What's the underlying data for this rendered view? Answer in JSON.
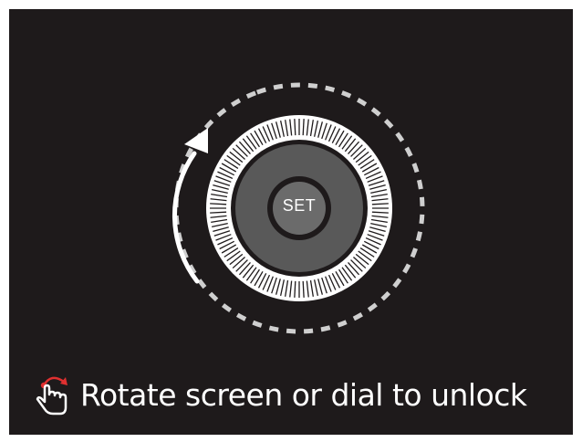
{
  "dial": {
    "center_label": "SET"
  },
  "hint": {
    "text": "Rotate screen or dial to unlock",
    "icon": "rotate-gesture-hand-icon"
  },
  "colors": {
    "screen_background": "#1e1a1b",
    "dial_face": "#595959",
    "dial_ring": "#ffffff",
    "dashed_track": "#cfcfcf",
    "arrow": "#ffffff",
    "hint_text": "#ffffff",
    "gesture_accent": "#e03030"
  }
}
